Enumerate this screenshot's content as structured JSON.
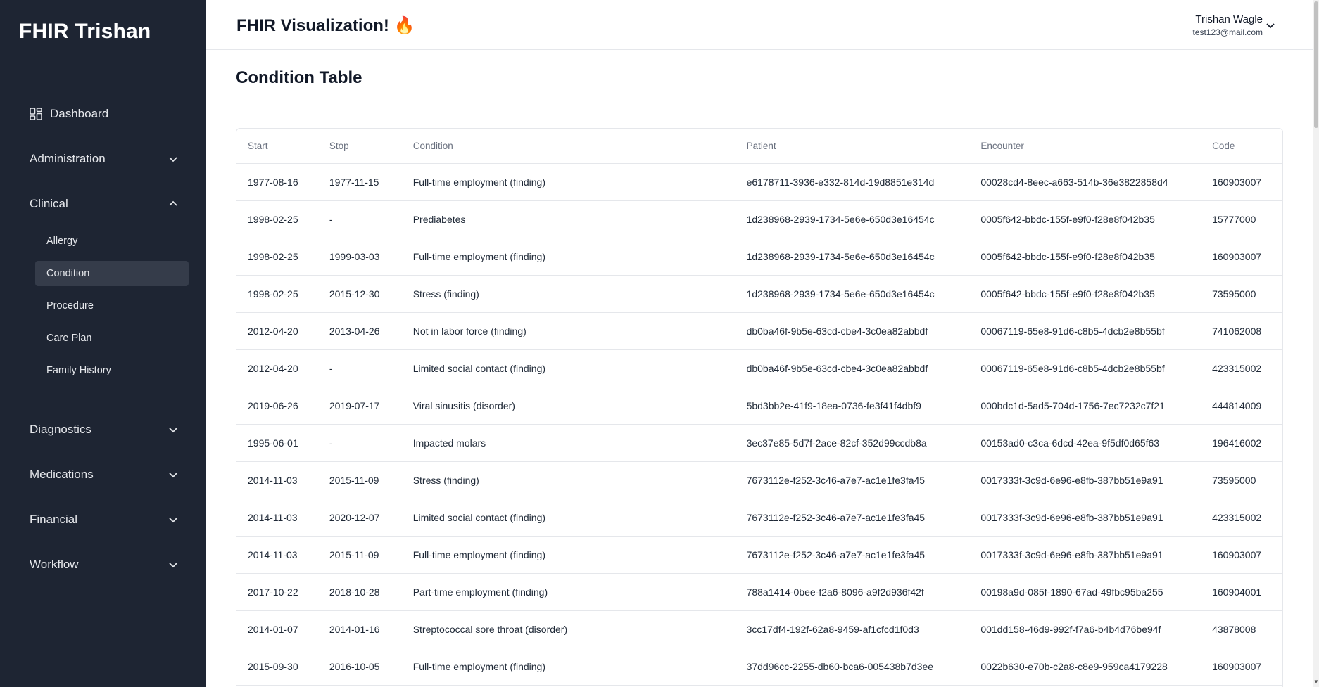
{
  "sidebar": {
    "brand": "FHIR Trishan",
    "items": [
      {
        "label": "Dashboard"
      },
      {
        "label": "Administration"
      },
      {
        "label": "Clinical"
      },
      {
        "label": "Diagnostics"
      },
      {
        "label": "Medications"
      },
      {
        "label": "Financial"
      },
      {
        "label": "Workflow"
      }
    ],
    "clinical_sub": [
      {
        "label": "Allergy"
      },
      {
        "label": "Condition"
      },
      {
        "label": "Procedure"
      },
      {
        "label": "Care Plan"
      },
      {
        "label": "Family History"
      }
    ]
  },
  "header": {
    "title": "FHIR Visualization! 🔥",
    "user_name": "Trishan Wagle",
    "user_email": "test123@mail.com"
  },
  "main": {
    "title": "Condition Table",
    "columns": [
      "Start",
      "Stop",
      "Condition",
      "Patient",
      "Encounter",
      "Code"
    ],
    "rows": [
      [
        "1977-08-16",
        "1977-11-15",
        "Full-time employment (finding)",
        "e6178711-3936-e332-814d-19d8851e314d",
        "00028cd4-8eec-a663-514b-36e3822858d4",
        "160903007"
      ],
      [
        "1998-02-25",
        "-",
        "Prediabetes",
        "1d238968-2939-1734-5e6e-650d3e16454c",
        "0005f642-bbdc-155f-e9f0-f28e8f042b35",
        "15777000"
      ],
      [
        "1998-02-25",
        "1999-03-03",
        "Full-time employment (finding)",
        "1d238968-2939-1734-5e6e-650d3e16454c",
        "0005f642-bbdc-155f-e9f0-f28e8f042b35",
        "160903007"
      ],
      [
        "1998-02-25",
        "2015-12-30",
        "Stress (finding)",
        "1d238968-2939-1734-5e6e-650d3e16454c",
        "0005f642-bbdc-155f-e9f0-f28e8f042b35",
        "73595000"
      ],
      [
        "2012-04-20",
        "2013-04-26",
        "Not in labor force (finding)",
        "db0ba46f-9b5e-63cd-cbe4-3c0ea82abbdf",
        "00067119-65e8-91d6-c8b5-4dcb2e8b55bf",
        "741062008"
      ],
      [
        "2012-04-20",
        "-",
        "Limited social contact (finding)",
        "db0ba46f-9b5e-63cd-cbe4-3c0ea82abbdf",
        "00067119-65e8-91d6-c8b5-4dcb2e8b55bf",
        "423315002"
      ],
      [
        "2019-06-26",
        "2019-07-17",
        "Viral sinusitis (disorder)",
        "5bd3bb2e-41f9-18ea-0736-fe3f41f4dbf9",
        "000bdc1d-5ad5-704d-1756-7ec7232c7f21",
        "444814009"
      ],
      [
        "1995-06-01",
        "-",
        "Impacted molars",
        "3ec37e85-5d7f-2ace-82cf-352d99ccdb8a",
        "00153ad0-c3ca-6dcd-42ea-9f5df0d65f63",
        "196416002"
      ],
      [
        "2014-11-03",
        "2015-11-09",
        "Stress (finding)",
        "7673112e-f252-3c46-a7e7-ac1e1fe3fa45",
        "0017333f-3c9d-6e96-e8fb-387bb51e9a91",
        "73595000"
      ],
      [
        "2014-11-03",
        "2020-12-07",
        "Limited social contact (finding)",
        "7673112e-f252-3c46-a7e7-ac1e1fe3fa45",
        "0017333f-3c9d-6e96-e8fb-387bb51e9a91",
        "423315002"
      ],
      [
        "2014-11-03",
        "2015-11-09",
        "Full-time employment (finding)",
        "7673112e-f252-3c46-a7e7-ac1e1fe3fa45",
        "0017333f-3c9d-6e96-e8fb-387bb51e9a91",
        "160903007"
      ],
      [
        "2017-10-22",
        "2018-10-28",
        "Part-time employment (finding)",
        "788a1414-0bee-f2a6-8096-a9f2d936f42f",
        "00198a9d-085f-1890-67ad-49fbc95ba255",
        "160904001"
      ],
      [
        "2014-01-07",
        "2014-01-16",
        "Streptococcal sore throat (disorder)",
        "3cc17df4-192f-62a8-9459-af1cfcd1f0d3",
        "001dd158-46d9-992f-f7a6-b4b4d76be94f",
        "43878008"
      ],
      [
        "2015-09-30",
        "2016-10-05",
        "Full-time employment (finding)",
        "37dd96cc-2255-db60-bca6-005438b7d3ee",
        "0022b630-e70b-c2a8-c8e9-959ca4179228",
        "160903007"
      ]
    ]
  },
  "icons": {
    "dashboard": "dashboard-grid-icon",
    "chevron_down": "chevron-down-icon",
    "chevron_up": "chevron-up-icon"
  },
  "colors": {
    "sidebar_bg": "#1e2533",
    "active_item_bg": "#353c4a"
  }
}
